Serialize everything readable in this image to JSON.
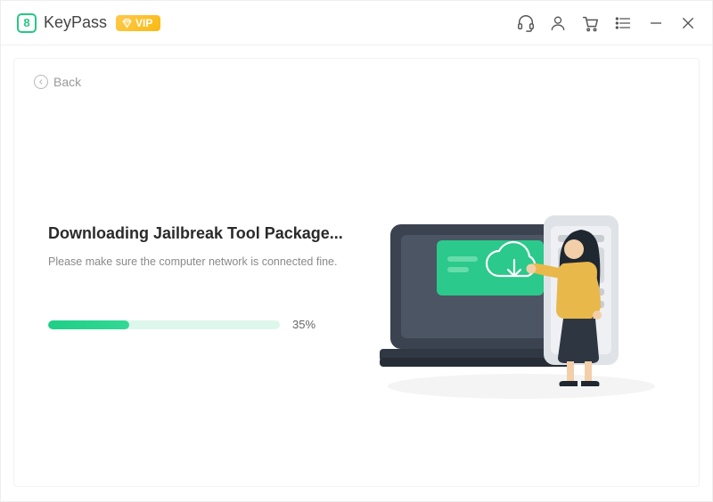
{
  "app": {
    "name": "KeyPass",
    "logo_letter": "8",
    "vip_label": "VIP"
  },
  "back": {
    "label": "Back"
  },
  "main": {
    "heading": "Downloading Jailbreak Tool Package...",
    "subtext": "Please make sure the computer network is connected fine.",
    "progress_pct": 35,
    "progress_label": "35%"
  },
  "colors": {
    "accent": "#26c884",
    "vip": "#f8bb14",
    "progress_bg": "#def7ec"
  }
}
